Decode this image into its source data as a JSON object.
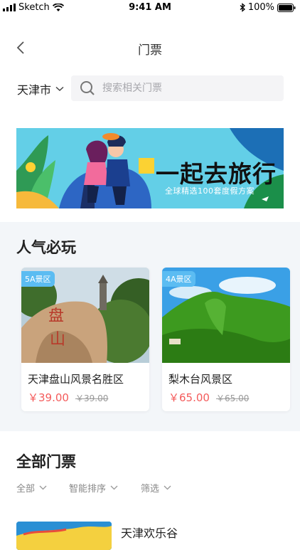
{
  "status_bar": {
    "carrier": "Sketch",
    "time": "9:41 AM",
    "battery": "100%"
  },
  "nav": {
    "title": "门票",
    "back_icon": "chevron-left-icon"
  },
  "city": {
    "name": "天津市"
  },
  "search": {
    "placeholder": "搜索相关门票"
  },
  "banner": {
    "title": "一起去旅行",
    "subtitle": "全球精选100套度假方案"
  },
  "popular": {
    "title": "人气必玩",
    "items": [
      {
        "badge": "5A景区",
        "name": "天津盘山风景名胜区",
        "price": "￥39.00",
        "original_price": "￥39.00"
      },
      {
        "badge": "4A景区",
        "name": "梨木台风景区",
        "price": "￥65.00",
        "original_price": "￥65.00"
      }
    ]
  },
  "all_tickets": {
    "title": "全部门票",
    "filters": [
      {
        "label": "全部"
      },
      {
        "label": "智能排序"
      },
      {
        "label": "筛选"
      }
    ],
    "list": [
      {
        "name": "天津欢乐谷"
      }
    ]
  },
  "colors": {
    "price": "#f45b5b",
    "badge": "#5bbcf2",
    "section_bg": "#f3f6f9",
    "search_bg": "#f4f4f6"
  }
}
